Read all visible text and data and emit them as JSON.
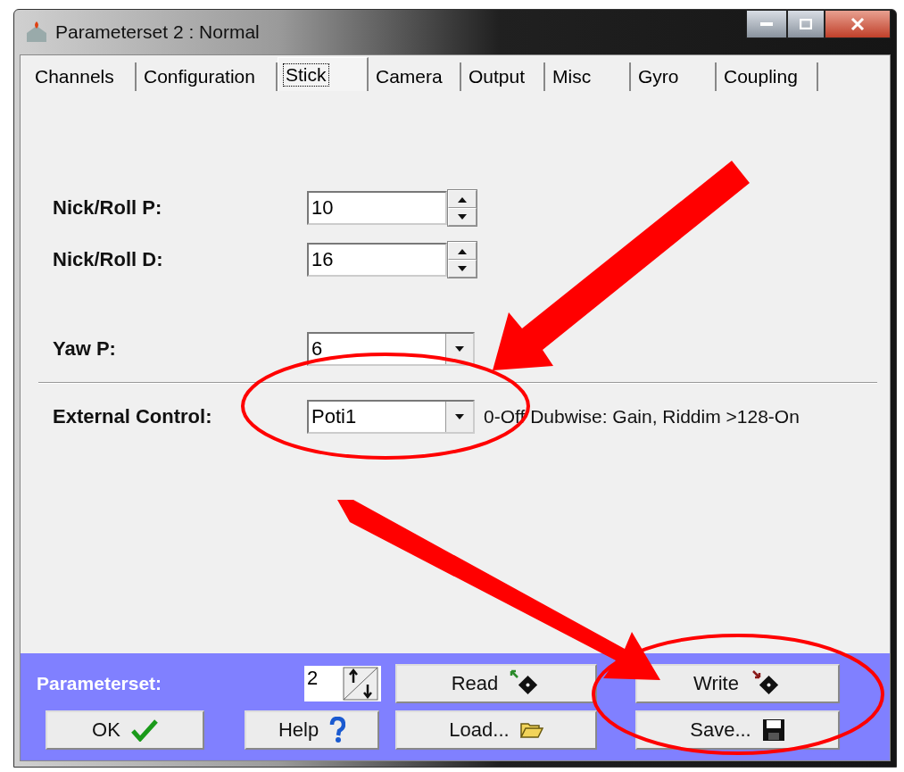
{
  "window": {
    "title": "Parameterset 2 : Normal"
  },
  "tabs": [
    {
      "label": "Channels",
      "selected": false
    },
    {
      "label": "Configuration",
      "selected": false
    },
    {
      "label": "Stick",
      "selected": true
    },
    {
      "label": "Camera",
      "selected": false
    },
    {
      "label": "Output",
      "selected": false
    },
    {
      "label": "Misc",
      "selected": false
    },
    {
      "label": "Gyro",
      "selected": false
    },
    {
      "label": "Coupling",
      "selected": false
    }
  ],
  "settings": [
    {
      "kind": "spin",
      "label": "Nick/Roll P:",
      "value": "10"
    },
    {
      "kind": "spin",
      "label": "Nick/Roll D:",
      "value": "16"
    },
    {
      "kind": "combo",
      "label": "Yaw P:",
      "value": "6"
    },
    {
      "kind": "combo",
      "label": "External Control:",
      "value": "Poti1",
      "hint": "0-Off Dubwise: Gain, Riddim >128-On"
    }
  ],
  "footer": {
    "label": "Parameterset:",
    "value": "2",
    "buttons": [
      {
        "kind": "read",
        "label": "Read"
      },
      {
        "kind": "write",
        "label": "Write"
      },
      {
        "kind": "ok",
        "label": "OK"
      },
      {
        "kind": "help",
        "label": "Help"
      },
      {
        "kind": "load",
        "label": "Load..."
      },
      {
        "kind": "save",
        "label": "Save..."
      }
    ]
  }
}
